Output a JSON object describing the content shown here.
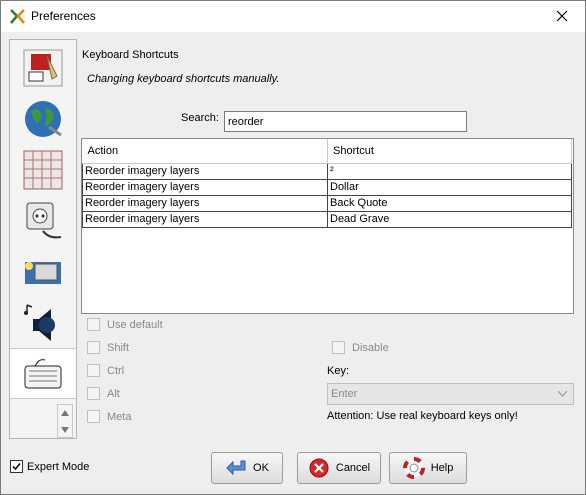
{
  "window": {
    "title": "Preferences",
    "icons": {
      "app": "josm-app-icon",
      "close": "close-icon"
    }
  },
  "sidebar": {
    "items": [
      {
        "name": "display-settings",
        "icon": "paint-brush-icon"
      },
      {
        "name": "map-settings",
        "icon": "globe-icon"
      },
      {
        "name": "projection",
        "icon": "grid-icon"
      },
      {
        "name": "connection",
        "icon": "plug-icon"
      },
      {
        "name": "advanced",
        "icon": "folder-icon"
      },
      {
        "name": "audio",
        "icon": "speaker-icon"
      },
      {
        "name": "shortcuts",
        "icon": "keyboard-icon",
        "selected": true
      }
    ]
  },
  "shortcuts": {
    "title": "Keyboard Shortcuts",
    "description": "Changing keyboard shortcuts manually.",
    "search_label": "Search:",
    "search_value": "reorder",
    "columns": [
      "Action",
      "Shortcut"
    ],
    "rows": [
      {
        "action": "Reorder imagery layers",
        "shortcut": "²"
      },
      {
        "action": "Reorder imagery layers",
        "shortcut": "Dollar"
      },
      {
        "action": "Reorder imagery layers",
        "shortcut": "Back Quote"
      },
      {
        "action": "Reorder imagery layers",
        "shortcut": "Dead Grave"
      }
    ],
    "use_default": "Use default",
    "shift": "Shift",
    "ctrl": "Ctrl",
    "alt": "Alt",
    "meta": "Meta",
    "disable": "Disable",
    "key_label": "Key:",
    "key_value": "Enter",
    "attention": "Attention: Use real keyboard keys only!"
  },
  "footer": {
    "expert_mode": "Expert Mode",
    "expert_checked": true,
    "ok": "OK",
    "cancel": "Cancel",
    "help": "Help"
  },
  "colors": {
    "accent_red": "#c0201f",
    "disabled_text": "#8a8a8a"
  }
}
